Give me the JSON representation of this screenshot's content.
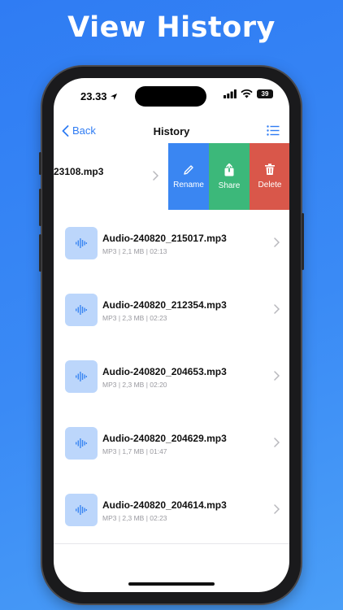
{
  "headline": "View History",
  "status": {
    "time": "23.33",
    "battery": "39"
  },
  "nav": {
    "back_label": "Back",
    "title": "History"
  },
  "swiped_row": {
    "name": "23108.mp3"
  },
  "swipe_actions": [
    {
      "label": "Rename",
      "color": "#3a86f2",
      "icon": "pencil-icon"
    },
    {
      "label": "Share",
      "color": "#3cb87a",
      "icon": "share-icon"
    },
    {
      "label": "Delete",
      "color": "#d9574a",
      "icon": "trash-icon"
    }
  ],
  "files": [
    {
      "name": "Audio-240820_215017.mp3",
      "meta": "MP3 | 2,1 MB | 02:13"
    },
    {
      "name": "Audio-240820_212354.mp3",
      "meta": "MP3 | 2,3 MB | 02:23"
    },
    {
      "name": "Audio-240820_204653.mp3",
      "meta": "MP3 | 2,3 MB | 02:20"
    },
    {
      "name": "Audio-240820_204629.mp3",
      "meta": "MP3 | 1,7 MB | 01:47"
    },
    {
      "name": "Audio-240820_204614.mp3",
      "meta": "MP3 | 2,3 MB | 02:23"
    }
  ],
  "colors": {
    "accent": "#2f7cf3",
    "thumb_bg": "#bcd6fb"
  }
}
